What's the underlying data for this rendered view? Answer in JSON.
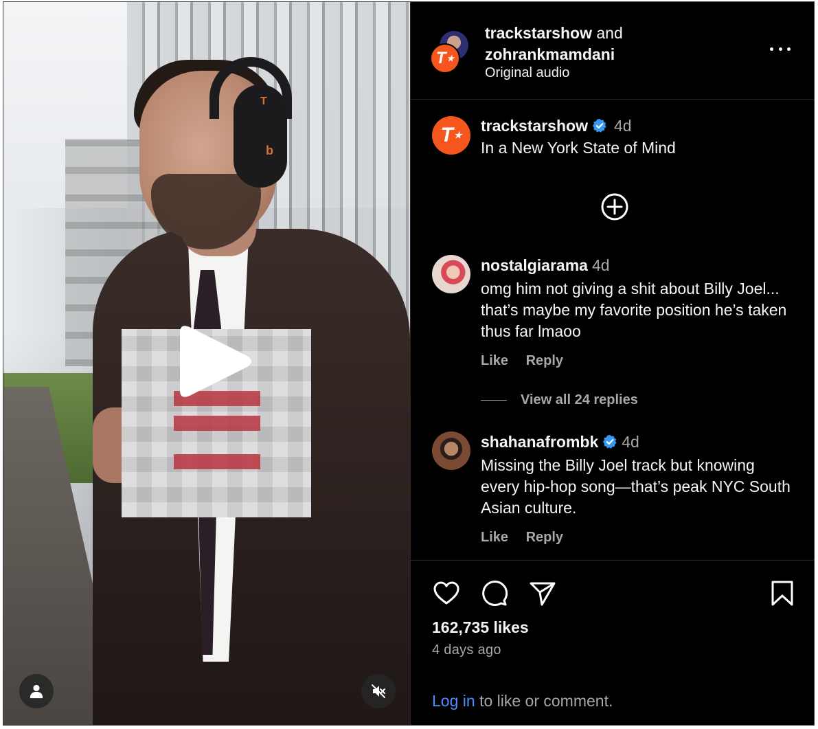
{
  "video": {
    "play_label": "play",
    "headphone_logo_top": "T",
    "headphone_logo_bottom": "b"
  },
  "header": {
    "user1": "trackstarshow",
    "connector": "and",
    "user2": "zohrankmamdani",
    "audio": "Original audio",
    "avatar_letter": "T"
  },
  "caption": {
    "username": "trackstarshow",
    "verified": true,
    "time": "4d",
    "text": "In a New York State of Mind",
    "avatar_letter": "T"
  },
  "comments": [
    {
      "username": "nostalgiarama",
      "verified": false,
      "time": "4d",
      "text": "omg him not giving a shit about Billy Joel... that’s maybe my favorite position he’s taken thus far lmaoo",
      "like_label": "Like",
      "reply_label": "Reply"
    },
    {
      "username": "shahanafrombk",
      "verified": true,
      "time": "4d",
      "text": "Missing the Billy Joel track but knowing every hip-hop song—that’s peak NYC South Asian culture.",
      "like_label": "Like",
      "reply_label": "Reply"
    }
  ],
  "view_replies": "View all 24 replies",
  "likes": "162,735 likes",
  "date": "4 days ago",
  "login": {
    "link": "Log in",
    "rest": "to like or comment."
  },
  "colors": {
    "brand_orange": "#f4561d",
    "verified_blue": "#3897f0",
    "link_blue": "#4c8dff",
    "muted": "#a8a8a8"
  },
  "icons": {
    "more": "more-icon",
    "plus": "plus-circle-icon",
    "like": "heart-icon",
    "comment": "comment-icon",
    "share": "send-icon",
    "save": "bookmark-icon",
    "user": "user-icon",
    "mute": "speaker-muted-icon",
    "play": "play-icon"
  }
}
